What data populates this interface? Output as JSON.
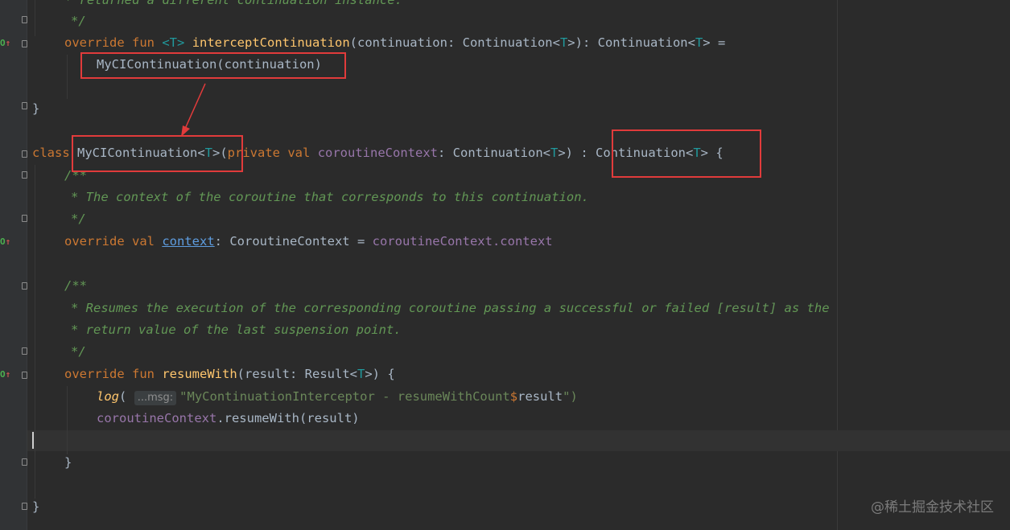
{
  "editor": {
    "lines": {
      "l0": "* returned a different continuation instance.",
      "l1": "*/",
      "l2_override": "override",
      "l2_fun": "fun",
      "l2_typeparam": "<T>",
      "l2_name": "interceptContinuation",
      "l2_rest1": "(continuation: Continuation<",
      "l2_t1": "T",
      "l2_rest2": ">): Continuation<",
      "l2_t2": "T",
      "l2_rest3": "> =",
      "l3": "MyCIContinuation(continuation)",
      "l5": "}",
      "l6_class": "class",
      "l6_name": "MyCIContinuation<",
      "l6_t": "T",
      "l6_paren": ">(",
      "l6_private": "private",
      "l6_val": "val",
      "l6_field": "coroutineContext",
      "l6_rest1": ": Continuation<",
      "l6_t2": "T",
      "l6_rest2": ">)",
      "l6_rest3": " : Continuation<",
      "l6_t3": "T",
      "l6_rest4": "> {",
      "l7": "/**",
      "l8": "* The context of the coroutine that corresponds to this continuation.",
      "l9": "*/",
      "l10_override": "override",
      "l10_val": "val",
      "l10_context": "context",
      "l10_type": ": CoroutineContext = ",
      "l10_field": "coroutineContext",
      "l10_tail": ".context",
      "l12": "/**",
      "l13a": "* Resumes the execution of the corresponding coroutine passing a successful or failed ",
      "l13ref": "[result]",
      "l13b": " as the",
      "l14": "* return value of the last suspension point.",
      "l15": "*/",
      "l16_override": "override",
      "l16_fun": "fun",
      "l16_name": "resumeWith",
      "l16_rest1": "(result: Result<",
      "l16_t": "T",
      "l16_rest2": ">) {",
      "l17_log": "log",
      "l17_paren": "(",
      "l17_hint": "...msg:",
      "l17_str": "\"MyContinuationInterceptor - resumeWithCount",
      "l17_dollar": "$",
      "l17_var": "result",
      "l17_end": "\")",
      "l18_field": "coroutineContext",
      "l18_rest": ".resumeWith(result)",
      "l20": "}",
      "l22": "}"
    }
  },
  "watermark": "@稀土掘金技术社区",
  "colors": {
    "background": "#2b2b2b",
    "keyword": "#cc7832",
    "function": "#ffc66d",
    "type_param": "#20999d",
    "doc_comment": "#629755",
    "field": "#9876aa",
    "annotation_box": "#e13b3b"
  }
}
